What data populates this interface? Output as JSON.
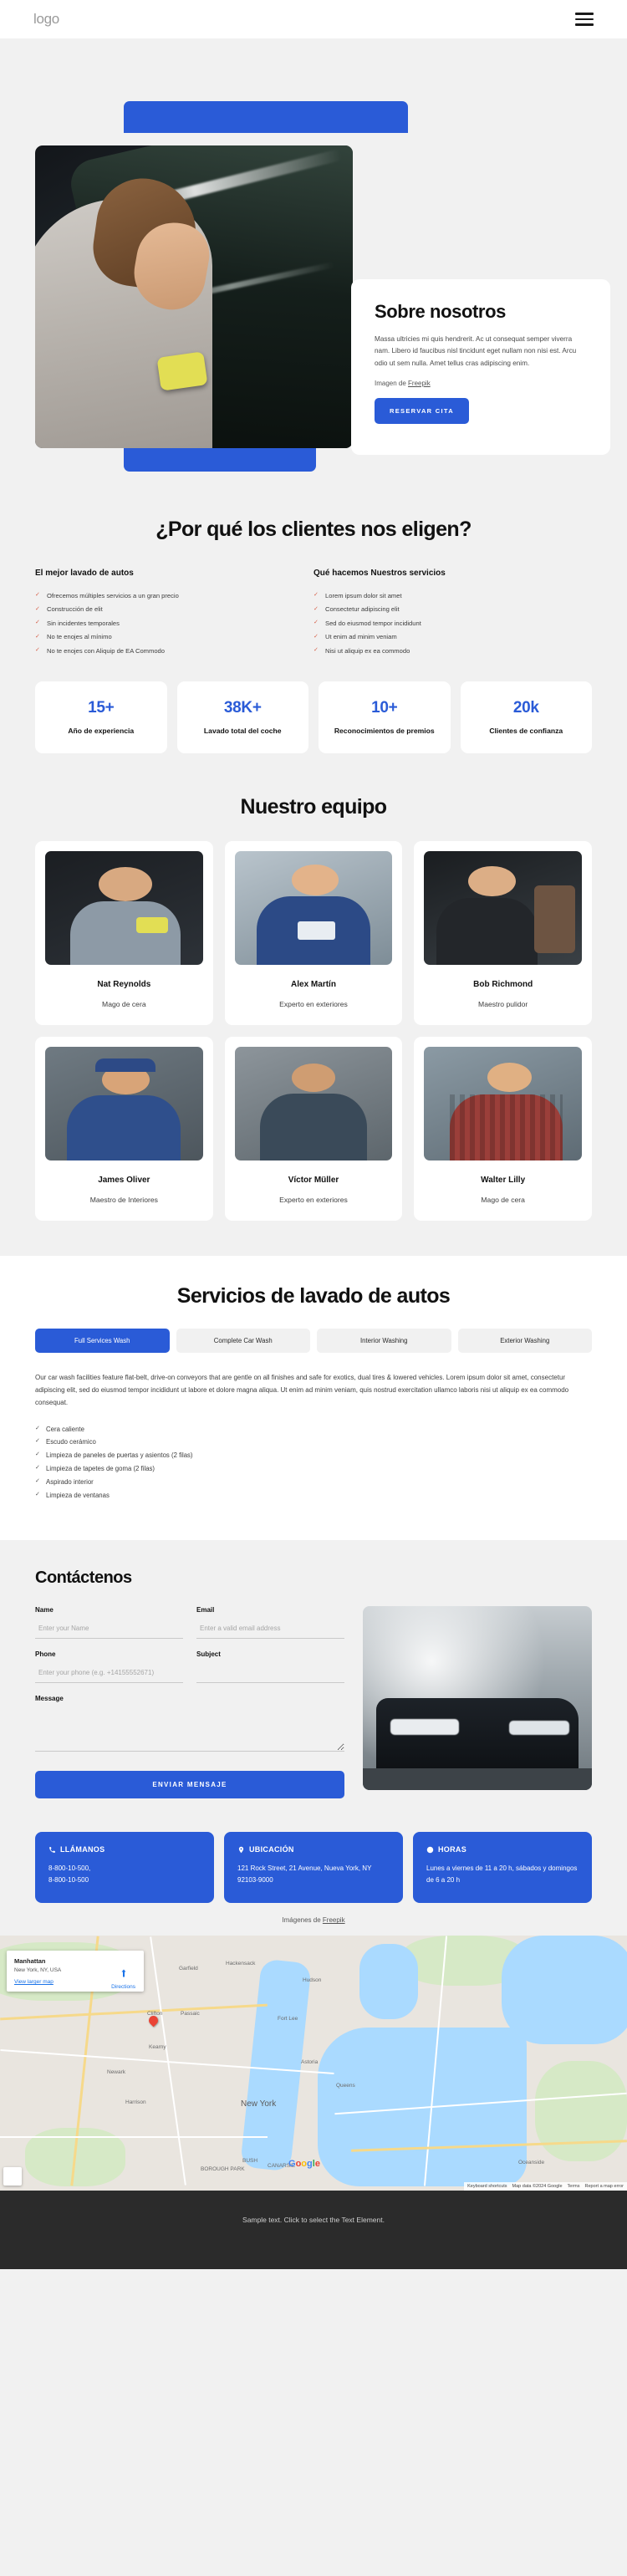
{
  "header": {
    "logo": "logo",
    "menu_icon": "hamburger-menu-icon"
  },
  "hero": {
    "title": "Sobre nosotros",
    "paragraph": "Massa ultricies mi quis hendrerit. Ac ut consequat semper viverra nam. Libero id faucibus nisl tincidunt eget nullam non nisi est. Arcu odio ut sem nulla. Amet tellus cras adipiscing enim.",
    "credit_prefix": "Imagen de ",
    "credit_link": "Freepik",
    "cta": "RESERVAR CITA"
  },
  "why": {
    "title": "¿Por qué los clientes nos eligen?",
    "columns": [
      {
        "heading": "El mejor lavado de autos",
        "items": [
          "Ofrecemos múltiples servicios a un gran precio",
          "Construcción de elit",
          "Sin incidentes temporales",
          "No te enojes al mínimo",
          "No te enojes con Aliquip de EA Commodo"
        ]
      },
      {
        "heading": "Qué hacemos Nuestros servicios",
        "items": [
          "Lorem ipsum dolor sit amet",
          "Consectetur adipiscing elit",
          "Sed do eiusmod tempor incididunt",
          "Ut enim ad minim veniam",
          "Nisi ut aliquip ex ea commodo"
        ]
      }
    ]
  },
  "stats": [
    {
      "num": "15+",
      "label": "Año de experiencia"
    },
    {
      "num": "38K+",
      "label": "Lavado total del coche"
    },
    {
      "num": "10+",
      "label": "Reconocimientos de premios"
    },
    {
      "num": "20k",
      "label": "Clientes de confianza"
    }
  ],
  "team": {
    "title": "Nuestro equipo",
    "members": [
      {
        "name": "Nat Reynolds",
        "role": "Mago de cera"
      },
      {
        "name": "Alex Martín",
        "role": "Experto en exteriores"
      },
      {
        "name": "Bob Richmond",
        "role": "Maestro pulidor"
      },
      {
        "name": "James Oliver",
        "role": "Maestro de Interiores"
      },
      {
        "name": "Víctor Müller",
        "role": "Experto en exteriores"
      },
      {
        "name": "Walter Lilly",
        "role": "Mago de cera"
      }
    ]
  },
  "services": {
    "title": "Servicios de lavado de autos",
    "tabs": [
      {
        "label": "Full Services Wash",
        "active": true
      },
      {
        "label": "Complete Car Wash",
        "active": false
      },
      {
        "label": "Interior Washing",
        "active": false
      },
      {
        "label": "Exterior Washing",
        "active": false
      }
    ],
    "paragraph": "Our car wash facilities feature flat-belt, drive-on conveyors that are gentle on all finishes and safe for exotics, dual tires & lowered vehicles. Lorem ipsum dolor sit amet, consectetur adipiscing elit, sed do eiusmod tempor incididunt ut labore et dolore magna aliqua. Ut enim ad minim veniam, quis nostrud exercitation ullamco laboris nisi ut aliquip ex ea commodo consequat.",
    "items": [
      "Cera caliente",
      "Escudo cerámico",
      "Limpieza de paneles de puertas y asientos (2 filas)",
      "Limpieza de tapetes de goma (2 filas)",
      "Aspirado interior",
      "Limpieza de ventanas"
    ]
  },
  "contact": {
    "title": "Contáctenos",
    "fields": {
      "name_label": "Name",
      "name_placeholder": "Enter your Name",
      "email_label": "Email",
      "email_placeholder": "Enter a valid email address",
      "phone_label": "Phone",
      "phone_placeholder": "Enter your phone (e.g. +14155552671)",
      "subject_label": "Subject",
      "subject_placeholder": "",
      "message_label": "Message",
      "message_placeholder": ""
    },
    "submit": "ENVIAR MENSAJE"
  },
  "info_cards": [
    {
      "icon": "phone-icon",
      "title": "LLÁMANOS",
      "text": "8-800-10-500,\n8-800-10-500"
    },
    {
      "icon": "location-icon",
      "title": "UBICACIÓN",
      "text": "121 Rock Street, 21 Avenue, Nueva York, NY 92103-9000"
    },
    {
      "icon": "clock-icon",
      "title": "HORAS",
      "text": "Lunes a viernes de 11 a 20 h, sábados y domingos de 6 a 20 h"
    }
  ],
  "images_credit": {
    "prefix": "Imágenes de ",
    "link": "Freepik"
  },
  "map": {
    "card_title": "Manhattan",
    "card_subtitle": "New York, NY, USA",
    "card_link": "View larger map",
    "directions": "Directions",
    "brand": "Google",
    "labels": [
      "Garfield",
      "Clifton",
      "Passaic",
      "Hackensack",
      "Fort Lee",
      "Newark",
      "New York",
      "Hudson",
      "BOROUGH PARK",
      "CANARSIE",
      "Oceanside",
      "BUSH",
      "Astoria",
      "Queens",
      "Harrison",
      "Kearny"
    ],
    "attribution": [
      "Keyboard shortcuts",
      "Map data ©2024 Google",
      "Terms",
      "Report a map error"
    ]
  },
  "footer": {
    "text": "Sample text. Click to select the Text Element."
  },
  "colors": {
    "accent": "#2a5bd7",
    "page_bg": "#f1f1f1",
    "footer_bg": "#2b2b2b",
    "check": "#d6604a"
  }
}
